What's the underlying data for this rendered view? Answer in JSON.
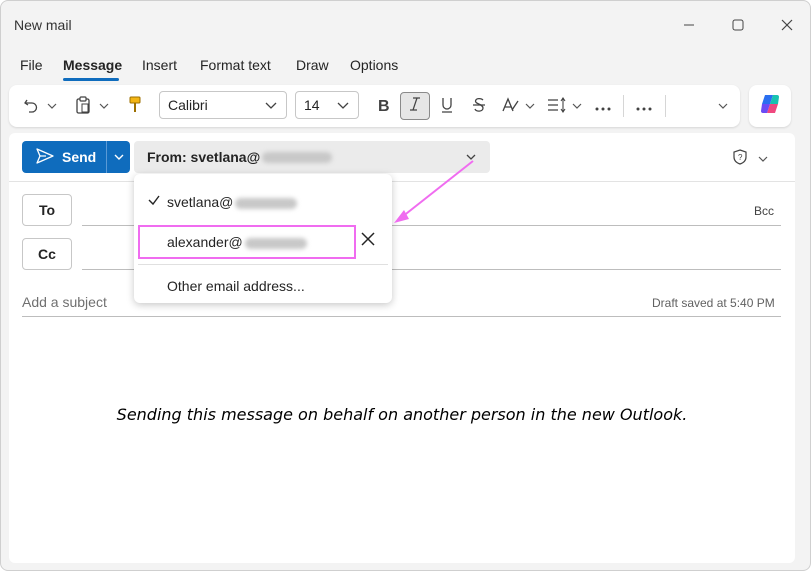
{
  "window": {
    "title": "New mail"
  },
  "menu": {
    "items": [
      "File",
      "Message",
      "Insert",
      "Format text",
      "Draw",
      "Options"
    ],
    "active": "Message"
  },
  "toolbar": {
    "font_name": "Calibri",
    "font_size": "14"
  },
  "compose": {
    "send_label": "Send",
    "from_label": "From: svetlana@",
    "to_label": "To",
    "cc_label": "Cc",
    "bcc_label": "Bcc",
    "subject_placeholder": "Add a subject",
    "draft_status": "Draft saved at 5:40 PM"
  },
  "from_dropdown": {
    "options": [
      "svetlana@",
      "alexander@"
    ],
    "selected_index": 0,
    "other_option": "Other email address..."
  },
  "caption": "Sending this message on behalf on another person in the new Outlook.",
  "colors": {
    "accent": "#0f6cbd",
    "annotation": "#f06cf0"
  }
}
